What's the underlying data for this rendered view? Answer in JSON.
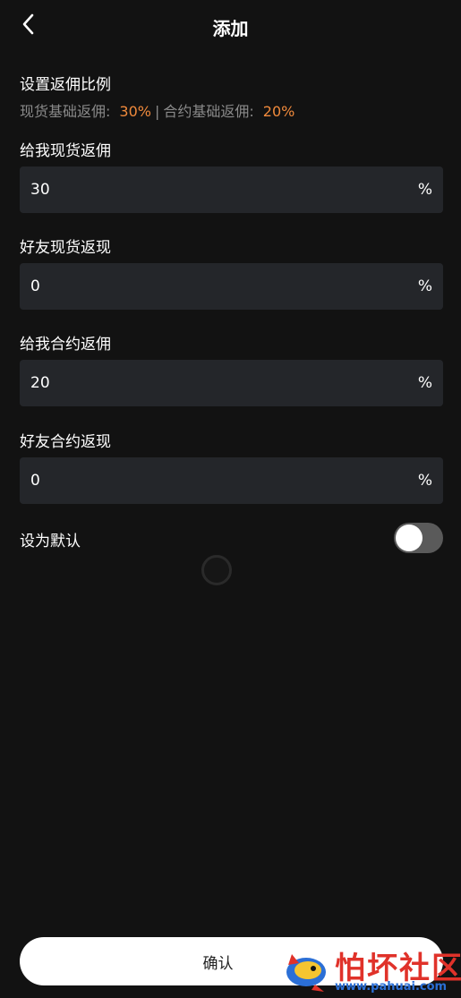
{
  "header": {
    "title": "添加",
    "back_icon": "chevron-left-icon"
  },
  "rebate_ratio": {
    "title": "设置返佣比例",
    "spot_base_label": "现货基础返佣:",
    "spot_base_value": "30%",
    "separator": "|",
    "contract_base_label": "合约基础返佣:",
    "contract_base_value": "20%"
  },
  "fields": [
    {
      "label": "给我现货返佣",
      "value": "30",
      "unit": "%"
    },
    {
      "label": "好友现货返现",
      "value": "0",
      "unit": "%"
    },
    {
      "label": "给我合约返佣",
      "value": "20",
      "unit": "%"
    },
    {
      "label": "好友合约返现",
      "value": "0",
      "unit": "%"
    }
  ],
  "default_setting": {
    "label": "设为默认",
    "enabled": false
  },
  "confirm_button": {
    "label": "确认"
  },
  "watermark": {
    "name": "怕坏社区",
    "url": "www.pahuai.com"
  },
  "colors": {
    "background": "#121212",
    "input_background": "#24262a",
    "accent": "#f08a3c",
    "muted_text": "#8a8a8a",
    "toggle_off": "#5a5a5a",
    "button_background": "#ffffff"
  }
}
